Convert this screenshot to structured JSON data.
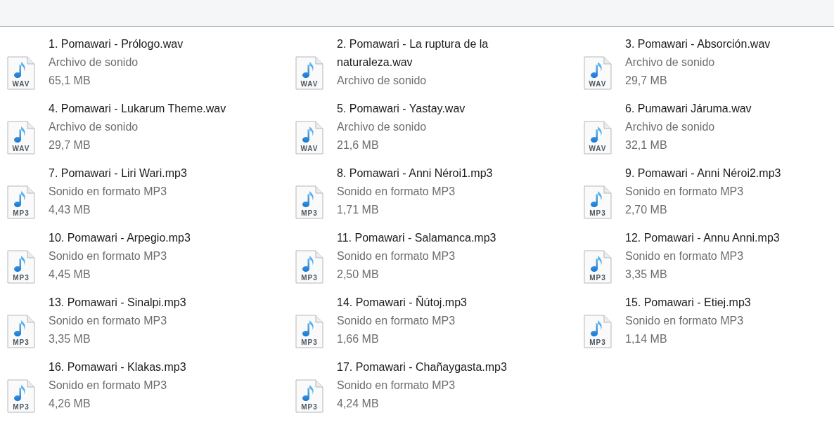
{
  "files": [
    {
      "name": "1. Pomawari - Prólogo.wav",
      "type": "Archivo de sonido",
      "size": "65,1 MB",
      "badge": "WAV"
    },
    {
      "name": "2. Pomawari - La ruptura de la naturaleza.wav",
      "type": "Archivo de sonido",
      "badge": "WAV"
    },
    {
      "name": "3. Pomawari - Absorción.wav",
      "type": "Archivo de sonido",
      "size": "29,7 MB",
      "badge": "WAV"
    },
    {
      "name": "4. Pomawari - Lukarum Theme.wav",
      "type": "Archivo de sonido",
      "size": "29,7 MB",
      "badge": "WAV"
    },
    {
      "name": "5. Pomawari - Yastay.wav",
      "type": "Archivo de sonido",
      "size": "21,6 MB",
      "badge": "WAV"
    },
    {
      "name": "6. Pumawari Járuma.wav",
      "type": "Archivo de sonido",
      "size": "32,1 MB",
      "badge": "WAV"
    },
    {
      "name": "7. Pomawari - Liri Wari.mp3",
      "type": "Sonido en formato MP3",
      "size": "4,43 MB",
      "badge": "MP3"
    },
    {
      "name": "8. Pomawari - Anni Néroi1.mp3",
      "type": "Sonido en formato MP3",
      "size": "1,71 MB",
      "badge": "MP3"
    },
    {
      "name": "9. Pomawari - Anni Néroi2.mp3",
      "type": "Sonido en formato MP3",
      "size": "2,70 MB",
      "badge": "MP3"
    },
    {
      "name": "10. Pomawari - Arpegio.mp3",
      "type": "Sonido en formato MP3",
      "size": "4,45 MB",
      "badge": "MP3"
    },
    {
      "name": "11. Pomawari - Salamanca.mp3",
      "type": "Sonido en formato MP3",
      "size": "2,50 MB",
      "badge": "MP3"
    },
    {
      "name": "12. Pomawari - Annu Anni.mp3",
      "type": "Sonido en formato MP3",
      "size": "3,35 MB",
      "badge": "MP3"
    },
    {
      "name": "13. Pomawari - Sinalpi.mp3",
      "type": "Sonido en formato MP3",
      "size": "3,35 MB",
      "badge": "MP3"
    },
    {
      "name": "14. Pomawari - Ñútoj.mp3",
      "type": "Sonido en formato MP3",
      "size": "1,66 MB",
      "badge": "MP3"
    },
    {
      "name": "15. Pomawari - Etiej.mp3",
      "type": "Sonido en formato MP3",
      "size": "1,14 MB",
      "badge": "MP3"
    },
    {
      "name": "16. Pomawari - Klakas.mp3",
      "type": "Sonido en formato MP3",
      "size": "4,26 MB",
      "badge": "MP3"
    },
    {
      "name": "17. Pomawari - Chañaygasta.mp3",
      "type": "Sonido en formato MP3",
      "size": "4,24 MB",
      "badge": "MP3"
    }
  ]
}
